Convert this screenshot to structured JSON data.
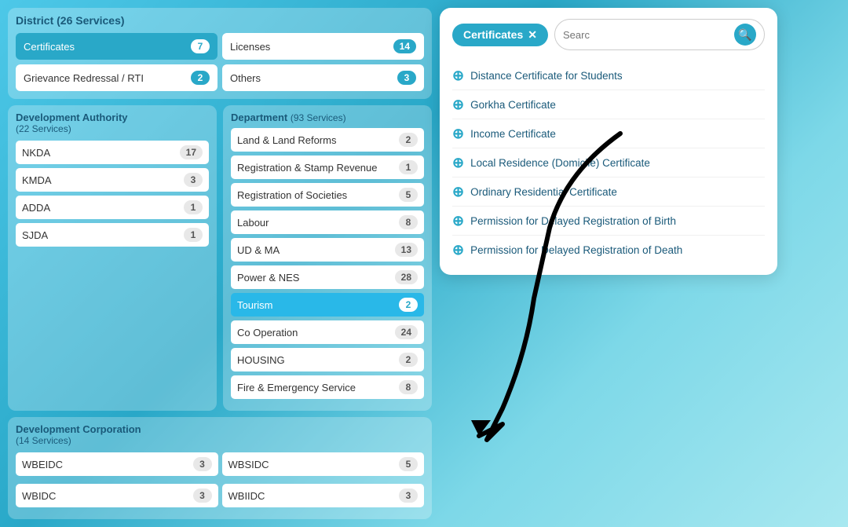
{
  "district": {
    "title": "District (26 Services)",
    "buttons": [
      {
        "label": "Certificates",
        "count": "7",
        "active": true
      },
      {
        "label": "Licenses",
        "count": "14",
        "active": false
      },
      {
        "label": "Grievance Redressal / RTI",
        "count": "2",
        "active": false
      },
      {
        "label": "Others",
        "count": "3",
        "active": false
      }
    ]
  },
  "developmentAuthority": {
    "title": "Development Authority",
    "subtitle": "(22 Services)",
    "items": [
      {
        "label": "NKDA",
        "count": "17"
      },
      {
        "label": "KMDA",
        "count": "3"
      },
      {
        "label": "ADDA",
        "count": "1"
      },
      {
        "label": "SJDA",
        "count": "1"
      }
    ]
  },
  "department": {
    "title": "Department",
    "subtitle": "(93 Services)",
    "items": [
      {
        "label": "Land & Land Reforms",
        "count": "2"
      },
      {
        "label": "Registration & Stamp Revenue",
        "count": "1"
      },
      {
        "label": "Registration of Societies",
        "count": "5"
      },
      {
        "label": "Labour",
        "count": "8"
      },
      {
        "label": "UD & MA",
        "count": "13"
      },
      {
        "label": "Power & NES",
        "count": "28"
      },
      {
        "label": "Tourism",
        "count": "2"
      },
      {
        "label": "Co Operation",
        "count": "24"
      },
      {
        "label": "HOUSING",
        "count": "2"
      },
      {
        "label": "Fire & Emergency Service",
        "count": "8"
      }
    ]
  },
  "developmentCorporation": {
    "title": "Development Corporation",
    "subtitle": "(14 Services)",
    "items": [
      {
        "label": "WBEIDC",
        "count": "3"
      },
      {
        "label": "WBSIDC",
        "count": "5"
      },
      {
        "label": "WBIDC",
        "count": "3"
      },
      {
        "label": "WBIIDC",
        "count": "3"
      }
    ]
  },
  "certificates": {
    "title": "Certificates",
    "close_label": "✕",
    "search_placeholder": "Searc",
    "items": [
      {
        "label": "Distance Certificate for Students"
      },
      {
        "label": "Gorkha Certificate"
      },
      {
        "label": "Income Certificate"
      },
      {
        "label": "Local Residence (Domicile) Certificate"
      },
      {
        "label": "Ordinary Residential Certificate"
      },
      {
        "label": "Permission for Delayed Registration of Birth"
      },
      {
        "label": "Permission for Delayed Registration of Death"
      }
    ]
  }
}
